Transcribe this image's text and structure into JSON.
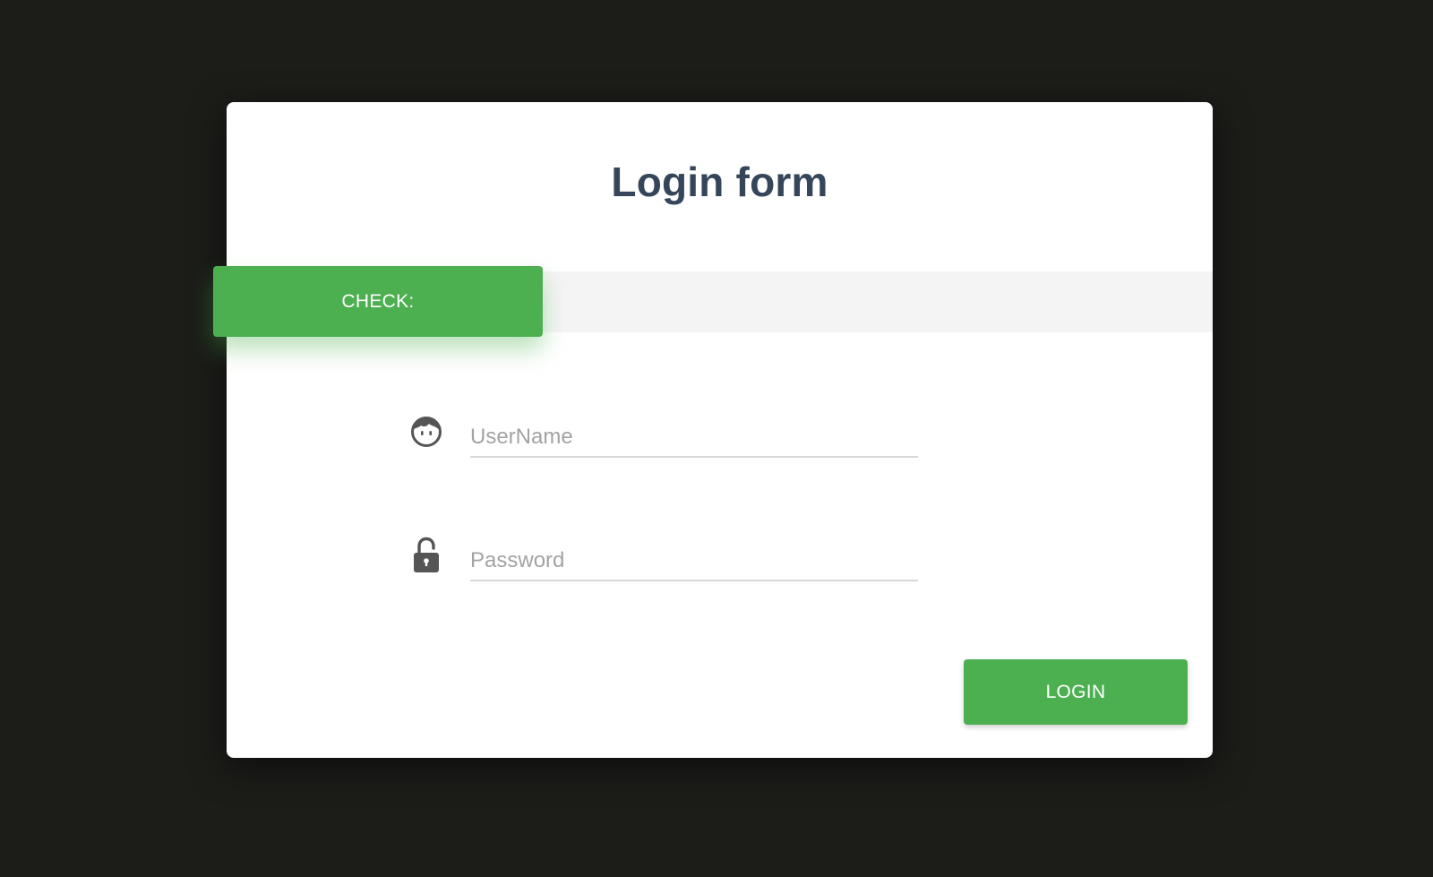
{
  "form": {
    "title": "Login form",
    "check_label": "CHECK:",
    "username": {
      "value": "",
      "placeholder": "UserName",
      "icon": "user-face-icon"
    },
    "password": {
      "value": "",
      "placeholder": "Password",
      "icon": "unlocked-padlock-icon"
    },
    "login_label": "LOGIN"
  },
  "colors": {
    "background": "#1c1d19",
    "card": "#ffffff",
    "accent": "#4caf50",
    "title": "#35455a",
    "strip": "#f4f4f4",
    "icon": "#555555"
  }
}
